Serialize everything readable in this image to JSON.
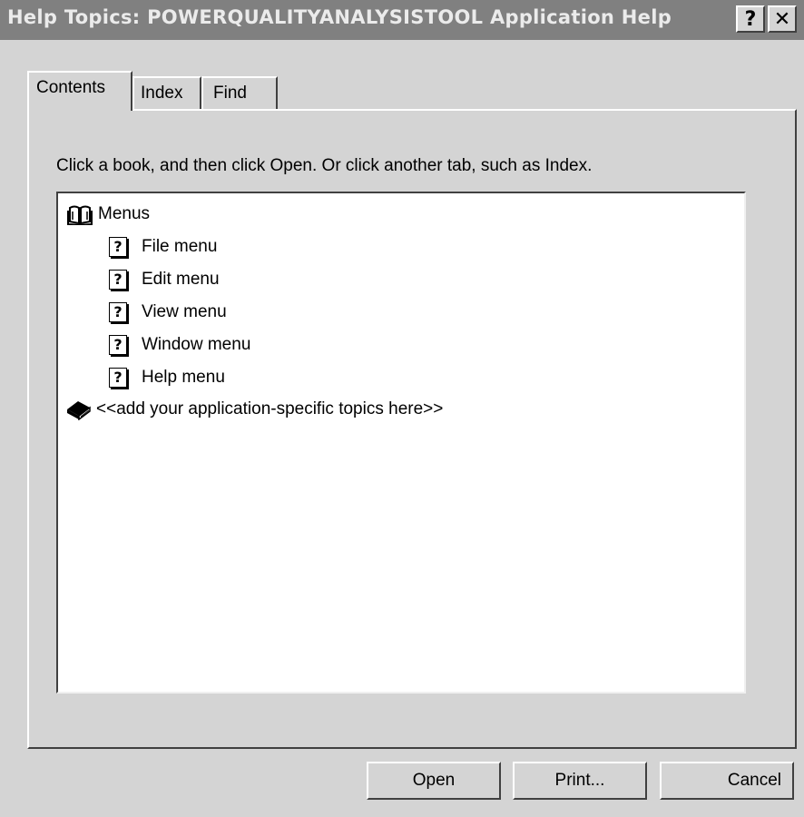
{
  "window": {
    "title": "Help Topics: POWERQUALITYANALYSISTOOL Application Help",
    "help_glyph": "?",
    "close_glyph": "✕"
  },
  "tabs": [
    {
      "label": "Contents",
      "selected": true
    },
    {
      "label": "Index",
      "selected": false
    },
    {
      "label": "Find",
      "selected": false
    }
  ],
  "instruction": "Click a book, and then click Open. Or click another tab, such as Index.",
  "tree": {
    "items": [
      {
        "label": "Menus",
        "icon": "open-book-icon",
        "level": 0
      },
      {
        "label": "File menu",
        "icon": "help-page-icon",
        "level": 1
      },
      {
        "label": "Edit menu",
        "icon": "help-page-icon",
        "level": 1
      },
      {
        "label": "View menu",
        "icon": "help-page-icon",
        "level": 1
      },
      {
        "label": "Window menu",
        "icon": "help-page-icon",
        "level": 1
      },
      {
        "label": "Help menu",
        "icon": "help-page-icon",
        "level": 1
      },
      {
        "label": "<<add your application-specific topics here>>",
        "icon": "closed-book-icon",
        "level": 0
      }
    ],
    "page_glyph": "?"
  },
  "buttons": {
    "open": "Open",
    "print": "Print...",
    "cancel": "Cancel"
  }
}
